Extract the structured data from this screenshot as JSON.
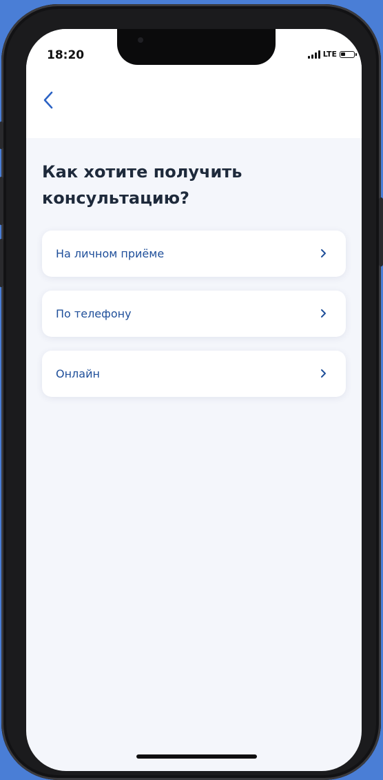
{
  "status_bar": {
    "time": "18:20",
    "network": "LTE"
  },
  "nav": {
    "back_icon": "chevron-left-icon"
  },
  "page": {
    "title": "Как хотите получить консультацию?"
  },
  "options": [
    {
      "label": "На личном приёме",
      "icon": "chevron-right-icon"
    },
    {
      "label": "По телефону",
      "icon": "chevron-right-icon"
    },
    {
      "label": "Онлайн",
      "icon": "chevron-right-icon"
    }
  ],
  "colors": {
    "background": "#4a7ed6",
    "accent": "#1f4f9a",
    "title": "#1e2a3b",
    "screen": "#f4f6fb"
  }
}
